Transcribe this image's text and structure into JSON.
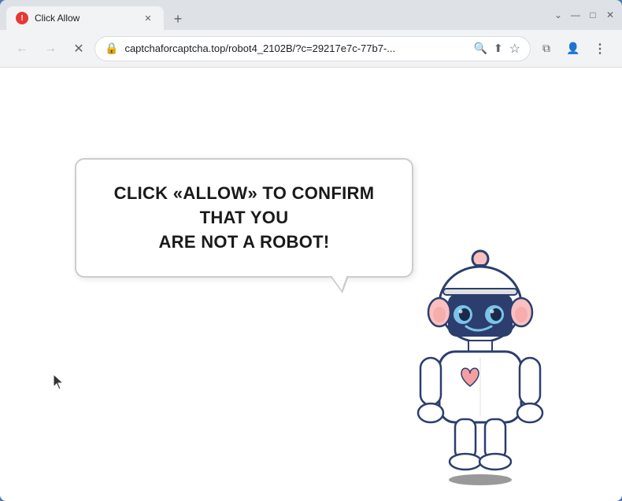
{
  "browser": {
    "title_bar": {
      "tab_title": "Click Allow",
      "new_tab_label": "+",
      "window_controls": {
        "chevron_down": "⌄",
        "minimize": "—",
        "maximize": "□",
        "close": "✕"
      }
    },
    "toolbar": {
      "back_label": "←",
      "forward_label": "→",
      "reload_label": "✕",
      "address": "captchaforcaptcha.top/robot4_2102B/?c=29217e7c-77b7-...",
      "search_icon": "🔍",
      "share_icon": "⬆",
      "bookmark_icon": "☆",
      "sidebar_icon": "⧉",
      "profile_icon": "👤",
      "menu_icon": "⋮"
    },
    "webpage": {
      "bubble_text_line1": "CLICK «ALLOW» TO CONFIRM THAT YOU",
      "bubble_text_line2": "ARE NOT A ROBOT!"
    }
  }
}
